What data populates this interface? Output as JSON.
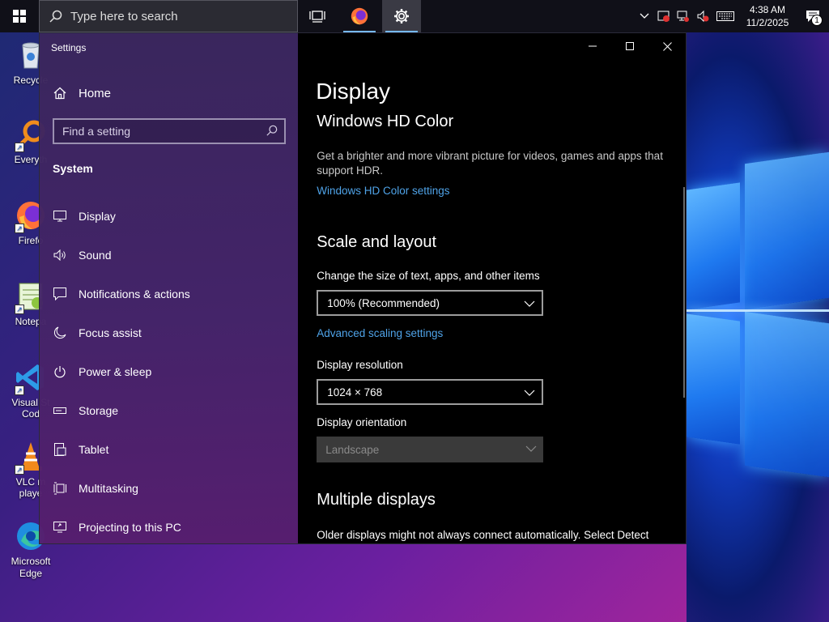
{
  "taskbar": {
    "search_placeholder": "Type here to search",
    "clock_time": "4:38 AM",
    "clock_date": "11/2/2025",
    "notification_count": "1"
  },
  "desktop": {
    "icons": [
      {
        "label": "Recycle"
      },
      {
        "label": "Everyth"
      },
      {
        "label": "Firefo"
      },
      {
        "label": "Notepa"
      },
      {
        "label": "Visual St Cod"
      },
      {
        "label": "VLC m playe"
      },
      {
        "label": "Microsoft Edge"
      }
    ]
  },
  "settings": {
    "window_title": "Settings",
    "home_label": "Home",
    "search_placeholder": "Find a setting",
    "section_title": "System",
    "nav_items": [
      {
        "label": "Display",
        "icon": "monitor-icon"
      },
      {
        "label": "Sound",
        "icon": "speaker-icon"
      },
      {
        "label": "Notifications & actions",
        "icon": "message-icon"
      },
      {
        "label": "Focus assist",
        "icon": "moon-icon"
      },
      {
        "label": "Power & sleep",
        "icon": "power-icon"
      },
      {
        "label": "Storage",
        "icon": "drive-icon"
      },
      {
        "label": "Tablet",
        "icon": "tablet-icon"
      },
      {
        "label": "Multitasking",
        "icon": "multitask-icon"
      },
      {
        "label": "Projecting to this PC",
        "icon": "project-icon"
      }
    ],
    "content": {
      "page_title": "Display",
      "hd_color_title": "Windows HD Color",
      "hd_color_desc": "Get a brighter and more vibrant picture for videos, games and apps that support HDR.",
      "hd_color_link": "Windows HD Color settings",
      "scale_title": "Scale and layout",
      "scale_label": "Change the size of text, apps, and other items",
      "scale_value": "100% (Recommended)",
      "advanced_link": "Advanced scaling settings",
      "resolution_label": "Display resolution",
      "resolution_value": "1024 × 768",
      "orientation_label": "Display orientation",
      "orientation_value": "Landscape",
      "multiple_title": "Multiple displays",
      "multiple_desc": "Older displays might not always connect automatically. Select Detect"
    }
  },
  "colors": {
    "accent_link": "#4fa3e8",
    "content_bg": "#000000",
    "taskbar_bg": "#101018"
  }
}
